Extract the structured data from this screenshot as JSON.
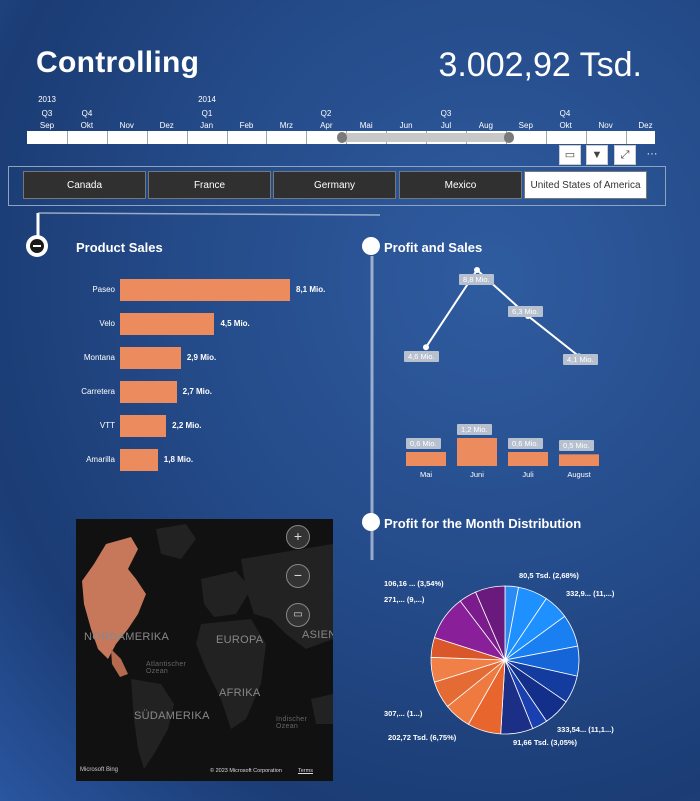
{
  "header": {
    "title": "Controlling",
    "total": "3.002,92 Tsd."
  },
  "timeline": {
    "years": [
      "2013",
      "2014"
    ],
    "quarters": [
      "Q3",
      "Q4",
      "Q1",
      "Q2",
      "Q3",
      "Q4"
    ],
    "months": [
      "Sep",
      "Okt",
      "Nov",
      "Dez",
      "Jan",
      "Feb",
      "Mrz",
      "Apr",
      "Mai",
      "Jun",
      "Jul",
      "Aug",
      "Sep",
      "Okt",
      "Nov",
      "Dez"
    ],
    "selected_range": [
      "Mai",
      "Aug"
    ]
  },
  "slicer": {
    "countries": [
      "Canada",
      "France",
      "Germany",
      "Mexico",
      "United States of America"
    ],
    "selected": "United States of America"
  },
  "product_sales": {
    "title": "Product Sales",
    "bar_color": "#ec8c5e",
    "items": [
      {
        "label": "Paseo",
        "value": 8.1,
        "value_label": "8,1 Mio."
      },
      {
        "label": "Velo",
        "value": 4.5,
        "value_label": "4,5 Mio."
      },
      {
        "label": "Montana",
        "value": 2.9,
        "value_label": "2,9 Mio."
      },
      {
        "label": "Carretera",
        "value": 2.7,
        "value_label": "2,7 Mio."
      },
      {
        "label": "VTT",
        "value": 2.2,
        "value_label": "2,2 Mio."
      },
      {
        "label": "Amarilla",
        "value": 1.8,
        "value_label": "1,8 Mio."
      }
    ]
  },
  "profit_sales": {
    "title": "Profit and Sales",
    "categories": [
      "Mai",
      "Juni",
      "Juli",
      "August"
    ],
    "sales": [
      4.6,
      8.8,
      6.3,
      4.1
    ],
    "sales_labels": [
      "4,6 Mio.",
      "8,8 Mio.",
      "6,3 Mio.",
      "4,1 Mio."
    ],
    "profit": [
      0.6,
      1.2,
      0.6,
      0.5
    ],
    "profit_labels": [
      "0,6 Mio.",
      "1,2 Mio.",
      "0,6 Mio.",
      "0,5 Mio."
    ]
  },
  "map": {
    "labels": [
      "NORDAMERIKA",
      "EUROPA",
      "ASIEN",
      "AFRIKA",
      "SÜDAMERIKA",
      "Atlantischer Ozean",
      "Indischer Ozean"
    ],
    "attribution": "© 2023 Microsoft Corporation",
    "terms": "Terms",
    "logo": "Microsoft Bing",
    "zoom_in": "+",
    "zoom_out": "−"
  },
  "chart_data": {
    "type": "pie",
    "title": "Profit for the Month Distribution",
    "slices": [
      {
        "label": "80,5 Tsd. (2,68%)",
        "percent": 2.68,
        "color": "#2a8bf2"
      },
      {
        "label": "332,9... (11,...)",
        "percent": 11.09,
        "color": "#1e90ff"
      },
      {
        "label": "333,54... (11,1...)",
        "percent": 11.11,
        "color": "#143b9e"
      },
      {
        "label": "91,66 Tsd. (3,05%)",
        "percent": 3.05,
        "color": "#1a3fae"
      },
      {
        "label": "202,72 Tsd. (6,75%)",
        "percent": 6.75,
        "color": "#e8652e"
      },
      {
        "label": "307,... (1...)",
        "percent": 10.23,
        "color": "#e56b35"
      },
      {
        "label": "271,... (9,...)",
        "percent": 9.03,
        "color": "#8a1f9a"
      },
      {
        "label": "106,16 ... (3,54%)",
        "percent": 3.54,
        "color": "#7a1c8c"
      }
    ],
    "unlabeled_remainder_percent": 42.55
  }
}
